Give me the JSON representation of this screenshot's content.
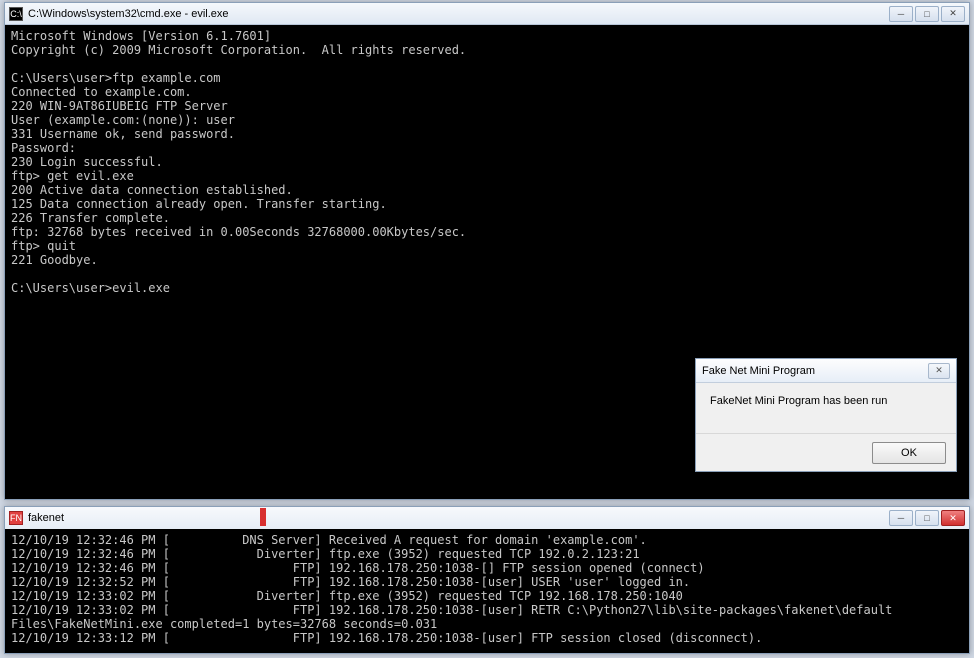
{
  "cmd": {
    "title": "C:\\Windows\\system32\\cmd.exe - evil.exe",
    "icon_label": "C:\\",
    "lines": [
      "Microsoft Windows [Version 6.1.7601]",
      "Copyright (c) 2009 Microsoft Corporation.  All rights reserved.",
      "",
      "C:\\Users\\user>ftp example.com",
      "Connected to example.com.",
      "220 WIN-9AT86IUBEIG FTP Server",
      "User (example.com:(none)): user",
      "331 Username ok, send password.",
      "Password:",
      "230 Login successful.",
      "ftp> get evil.exe",
      "200 Active data connection established.",
      "125 Data connection already open. Transfer starting.",
      "226 Transfer complete.",
      "ftp: 32768 bytes received in 0.00Seconds 32768000.00Kbytes/sec.",
      "ftp> quit",
      "221 Goodbye.",
      "",
      "C:\\Users\\user>evil.exe"
    ]
  },
  "fakenet": {
    "title": "fakenet",
    "icon_label": "FN",
    "lines": [
      "12/10/19 12:32:46 PM [          DNS Server] Received A request for domain 'example.com'.",
      "12/10/19 12:32:46 PM [            Diverter] ftp.exe (3952) requested TCP 192.0.2.123:21",
      "12/10/19 12:32:46 PM [                 FTP] 192.168.178.250:1038-[] FTP session opened (connect)",
      "12/10/19 12:32:52 PM [                 FTP] 192.168.178.250:1038-[user] USER 'user' logged in.",
      "12/10/19 12:33:02 PM [            Diverter] ftp.exe (3952) requested TCP 192.168.178.250:1040",
      "12/10/19 12:33:02 PM [                 FTP] 192.168.178.250:1038-[user] RETR C:\\Python27\\lib\\site-packages\\fakenet\\default",
      "Files\\FakeNetMini.exe completed=1 bytes=32768 seconds=0.031",
      "12/10/19 12:33:12 PM [                 FTP] 192.168.178.250:1038-[user] FTP session closed (disconnect)."
    ]
  },
  "dialog": {
    "title": "Fake Net Mini Program",
    "message": "FakeNet Mini Program has been run",
    "ok_label": "OK"
  },
  "win_controls": {
    "minimize": "─",
    "maximize": "□",
    "close": "✕"
  }
}
